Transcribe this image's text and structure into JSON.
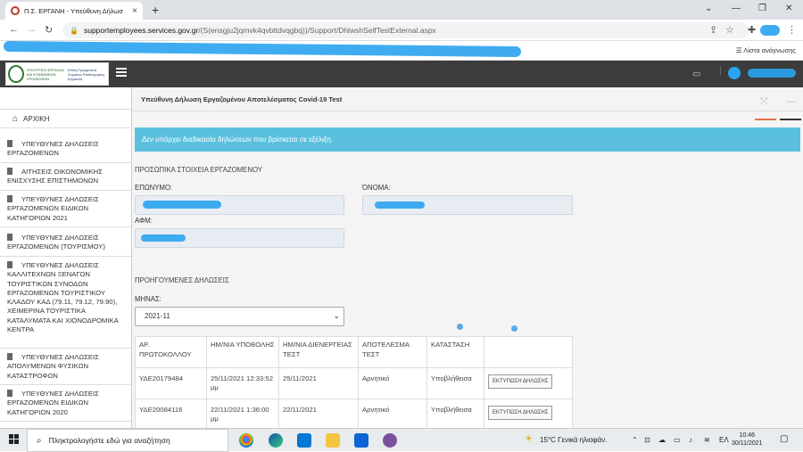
{
  "browser": {
    "tab_title": "Π.Σ. ΕΡΓΑΝΗ - Υπεύθυνη Δήλωσ",
    "tab_close": "×",
    "new_tab": "+",
    "url_host": "supportemployees.services.gov.gr",
    "url_path": "/(S(ensgju2jqmvk4qvbttdvqgbq))/Support/DhlwshSelfTestExternal.aspx",
    "reading_list": "Λίστα ανάγνωσης",
    "window_controls": [
      "—",
      "❐",
      "✕"
    ]
  },
  "app": {
    "logo_line1": "ΥΠΟΥΡΓΕΙΟ ΕΡΓΑΣΙΑΣ ΚΑΙ ΚΟΙΝΩΝΙΚΩΝ ΥΠΟΘΕΣΕΩΝ",
    "logo_line2": "Ειδική Γραμματεία Σώματος Επιθεώρησης Εργασίας",
    "page_title": "Υπεύθυνη Δήλωση Εργαζομένου Αποτελέσματος Covid-19 Test"
  },
  "sidebar": {
    "home": "ΑΡΧΙΚΗ",
    "items": [
      {
        "label": "ΥΠΕΥΘΥΝΕΣ ΔΗΛΩΣΕΙΣ ΕΡΓΑΖΟΜΕΝΩΝ"
      },
      {
        "label": "ΑΙΤΗΣΕΙΣ ΟΙΚΟΝΟΜΙΚΗΣ ΕΝΙΣΧΥΣΗΣ ΕΠΙΣΤΗΜΟΝΩΝ"
      },
      {
        "label": "ΥΠΕΥΘΥΝΕΣ ΔΗΛΩΣΕΙΣ ΕΡΓΑΖΟΜΕΝΩΝ ΕΙΔΙΚΩΝ ΚΑΤΗΓΟΡΙΩΝ 2021"
      },
      {
        "label": "ΥΠΕΥΘΥΝΕΣ ΔΗΛΩΣΕΙΣ ΕΡΓΑΖΟΜΕΝΩΝ (ΤΟΥΡΙΣΜΟΥ)"
      },
      {
        "label": "ΥΠΕΥΘΥΝΕΣ ΔΗΛΩΣΕΙΣ ΚΑΛΛΙΤΕΧΝΩΝ ΞΕΝΑΓΩΝ ΤΟΥΡΙΣΤΙΚΩΝ ΣΥΝΟΔΩΝ ΕΡΓΑΖΟΜΕΝΩΝ ΤΟΥΡΙΣΤΙΚΟΥ ΚΛΑΔΟΥ ΚΑΔ (79.11, 79.12, 79.90), ΧΕΙΜΕΡΙΝΑ ΤΟΥΡΙΣΤΙΚΑ ΚΑΤΑΛΥΜΑΤΑ ΚΑΙ ΧΙΟΝΟΔΡΟΜΙΚΑ ΚΕΝΤΡΑ"
      },
      {
        "label": "ΥΠΕΥΘΥΝΕΣ ΔΗΛΩΣΕΙΣ ΑΠΟΛΥΜΕΝΩΝ ΦΥΣΙΚΩΝ ΚΑΤΑΣΤΡΟΦΩΝ"
      },
      {
        "label": "ΥΠΕΥΘΥΝΕΣ ΔΗΛΩΣΕΙΣ ΕΡΓΑΖΟΜΕΝΩΝ ΕΙΔΙΚΩΝ ΚΑΤΗΓΟΡΙΩΝ 2020"
      }
    ]
  },
  "main": {
    "alert": "Δεν υπάρχει διαδικασία δηλώσεων που βρίσκεται σε εξέλιξη.",
    "personal_section": "ΠΡΟΣΩΠΙΚΑ ΣΤΟΙΧΕΙΑ ΕΡΓΑΖΟΜΕΝΟΥ",
    "surname_label": "ΕΠΩΝΥΜΟ:",
    "name_label": "ΌΝΟΜΑ:",
    "afm_label": "ΑΦΜ:",
    "previous_section": "ΠΡΟΗΓΟΥΜΕΝΕΣ ΔΗΛΩΣΕΙΣ",
    "month_label": "ΜΗΝΑΣ:",
    "month_value": "2021-11",
    "table": {
      "headers": [
        "ΑΡ. ΠΡΩΤΟΚΟΛΛΟΥ",
        "ΗΜ/ΝΙΑ ΥΠΟΒΟΛΗΣ",
        "ΗΜ/ΝΙΑ ΔΙΕΝΕΡΓΕΙΑΣ ΤΕΣΤ",
        "ΑΠΟΤΕΛΕΣΜΑ ΤΕΣΤ",
        "ΚΑΤΑΣΤΑΣΗ",
        ""
      ],
      "rows": [
        {
          "protocol": "ΥΔΕ20179484",
          "submitted": "25/11/2021 12:33:52 μμ",
          "test_date": "25/11/2021",
          "result": "Αρνητικό",
          "status": "Υποβλήθεισα",
          "print": "ΕΚΤΥΠΩΣΗ ΔΗΛΩΣΗΣ"
        },
        {
          "protocol": "ΥΔΕ20084116",
          "submitted": "22/11/2021 1:36:00 μμ",
          "test_date": "22/11/2021",
          "result": "Αρνητικό",
          "status": "Υποβλήθεισα",
          "print": "ΕΚΤΥΠΩΣΗ ΔΗΛΩΣΗΣ"
        }
      ]
    }
  },
  "taskbar": {
    "search_placeholder": "Πληκτρολογήστε εδώ για αναζήτηση",
    "weather": "15°C  Γενικά ηλιοφάν.",
    "language": "ΕΛ",
    "time": "10:46",
    "date": "30/11/2021"
  }
}
